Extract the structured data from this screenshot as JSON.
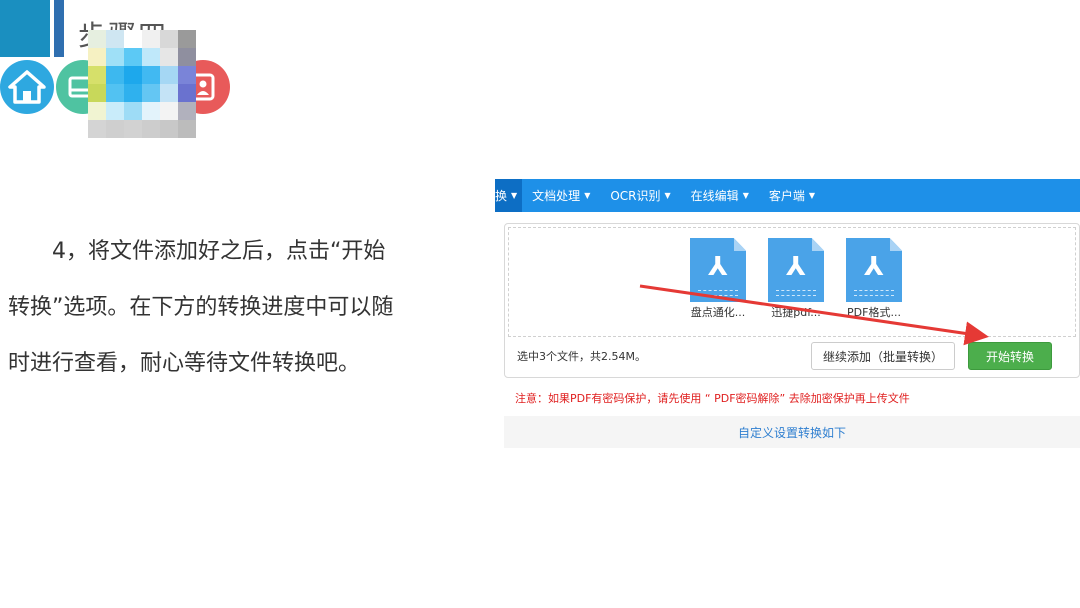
{
  "slide": {
    "title": "步骤四",
    "nav_icons": [
      "home-icon",
      "book-icon",
      "user-icon"
    ],
    "paragraph": "4，将文件添加好之后，点击“开始转换”选项。在下方的转换进度中可以随时进行查看，耐心等待文件转换吧。"
  },
  "app": {
    "nav": [
      "换",
      "文档处理",
      "OCR识别",
      "在线编辑",
      "客户端"
    ],
    "files": [
      "盘点通化...",
      "迅捷pdf...",
      "PDF格式..."
    ],
    "summary": "选中3个文件，共2.54M。",
    "add_button": "继续添加（批量转换）",
    "start_button": "开始转换",
    "notice": "注意：如果PDF有密码保护，请先使用 “ PDF密码解除” 去除加密保护再上传文件",
    "custom_settings": "自定义设置转换如下"
  },
  "colors": {
    "nav_bg": "#1e90e8",
    "start_button": "#4cae4c",
    "notice": "#e02020",
    "arrow": "#e53935"
  }
}
